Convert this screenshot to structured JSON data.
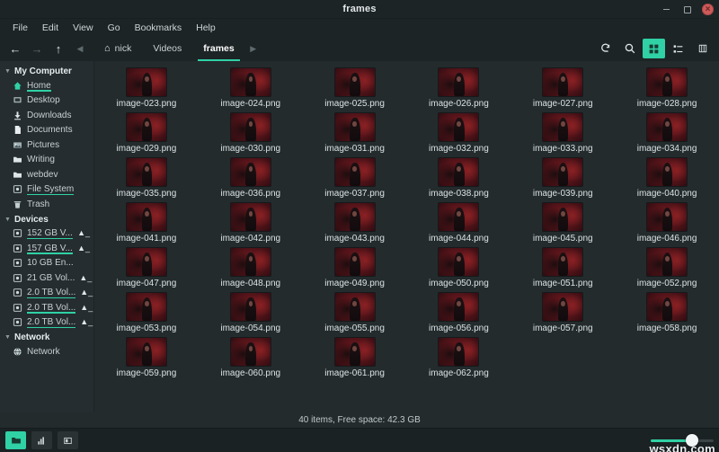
{
  "window": {
    "title": "frames",
    "controls": {
      "minimize": "minimize-button",
      "maximize": "maximize-button",
      "close": "close-button"
    }
  },
  "menubar": {
    "items": [
      "File",
      "Edit",
      "View",
      "Go",
      "Bookmarks",
      "Help"
    ]
  },
  "toolbar": {
    "nav": {
      "back": "←",
      "forward": "→",
      "up": "↑",
      "prev_crumb": "◀",
      "next_crumb": "▶"
    },
    "breadcrumbs": [
      {
        "label": "nick",
        "icon": "home-icon",
        "active": false
      },
      {
        "label": "Videos",
        "icon": "",
        "active": false
      },
      {
        "label": "frames",
        "icon": "",
        "active": true
      }
    ],
    "right_buttons": [
      {
        "name": "reload-icon",
        "glyph": "↷",
        "active": false
      },
      {
        "name": "search-icon",
        "glyph": "⚲",
        "active": false
      },
      {
        "name": "icon-view-icon",
        "glyph": "▒",
        "active": true
      },
      {
        "name": "list-view-icon",
        "glyph": "≣",
        "active": false
      },
      {
        "name": "compact-view-icon",
        "glyph": "⌸",
        "active": false
      }
    ]
  },
  "sidebar": {
    "groups": [
      {
        "label": "My Computer",
        "name": "sidebar-group-my-computer",
        "items": [
          {
            "label": "Home",
            "icon": "home-icon",
            "underline": true,
            "eject": false
          },
          {
            "label": "Desktop",
            "icon": "desktop-icon",
            "underline": false,
            "eject": false
          },
          {
            "label": "Downloads",
            "icon": "download-icon",
            "underline": false,
            "eject": false
          },
          {
            "label": "Documents",
            "icon": "document-icon",
            "underline": false,
            "eject": false
          },
          {
            "label": "Pictures",
            "icon": "picture-icon",
            "underline": false,
            "eject": false
          },
          {
            "label": "Writing",
            "icon": "folder-icon",
            "underline": false,
            "eject": false
          },
          {
            "label": "webdev",
            "icon": "folder-icon",
            "underline": false,
            "eject": false
          },
          {
            "label": "File System",
            "icon": "disk-icon",
            "underline": true,
            "eject": false
          },
          {
            "label": "Trash",
            "icon": "trash-icon",
            "underline": false,
            "eject": false
          }
        ]
      },
      {
        "label": "Devices",
        "name": "sidebar-group-devices",
        "items": [
          {
            "label": "152 GB V...",
            "icon": "disk-icon",
            "underline": true,
            "eject": true
          },
          {
            "label": "157 GB V...",
            "icon": "disk-icon",
            "underline": true,
            "eject": true
          },
          {
            "label": "10 GB En...",
            "icon": "disk-icon",
            "underline": false,
            "eject": false
          },
          {
            "label": "21 GB Vol...",
            "icon": "disk-icon",
            "underline": false,
            "eject": true
          },
          {
            "label": "2.0 TB Vol...",
            "icon": "disk-icon",
            "underline": true,
            "eject": true
          },
          {
            "label": "2.0 TB Vol...",
            "icon": "disk-icon",
            "underline": true,
            "eject": true
          },
          {
            "label": "2.0 TB Vol...",
            "icon": "disk-icon",
            "underline": true,
            "eject": true
          }
        ]
      },
      {
        "label": "Network",
        "name": "sidebar-group-network",
        "items": [
          {
            "label": "Network",
            "icon": "globe-icon",
            "underline": false,
            "eject": false
          }
        ]
      }
    ]
  },
  "files": {
    "columns": 6,
    "items": [
      "image-023.png",
      "image-024.png",
      "image-025.png",
      "image-026.png",
      "image-027.png",
      "image-028.png",
      "image-029.png",
      "image-030.png",
      "image-031.png",
      "image-032.png",
      "image-033.png",
      "image-034.png",
      "image-035.png",
      "image-036.png",
      "image-037.png",
      "image-038.png",
      "image-039.png",
      "image-040.png",
      "image-041.png",
      "image-042.png",
      "image-043.png",
      "image-044.png",
      "image-045.png",
      "image-046.png",
      "image-047.png",
      "image-048.png",
      "image-049.png",
      "image-050.png",
      "image-051.png",
      "image-052.png",
      "image-053.png",
      "image-054.png",
      "image-055.png",
      "image-056.png",
      "image-057.png",
      "image-058.png",
      "image-059.png",
      "image-060.png",
      "image-061.png",
      "image-062.png"
    ]
  },
  "statusbar": {
    "text": "40 items, Free space: 42.3 GB"
  },
  "dock": {
    "buttons": [
      {
        "name": "file-manager-taskbar-button",
        "glyph": "▰",
        "active": true
      },
      {
        "name": "terminal-taskbar-button",
        "glyph": "▐",
        "active": false
      },
      {
        "name": "window-taskbar-button",
        "glyph": "▣",
        "active": false
      }
    ],
    "zoom_slider": {
      "name": "zoom-slider",
      "value": 60
    }
  },
  "watermark": {
    "text": "wsxdn.com"
  },
  "colors": {
    "accent": "#2fd1a5",
    "titlebar": "#1d2426",
    "sidebar": "#252d30",
    "content": "#232b2d",
    "close": "#cf5a5a"
  }
}
